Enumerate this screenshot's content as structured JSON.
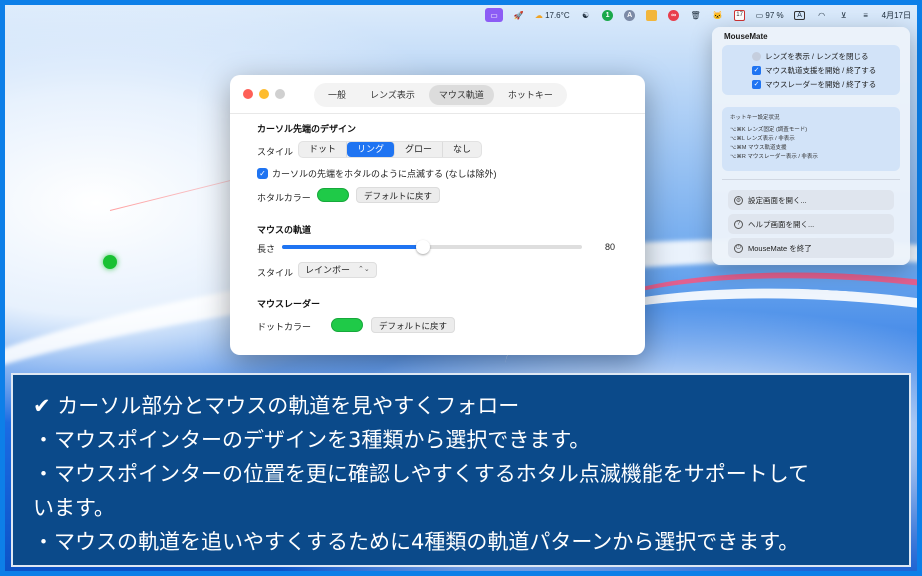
{
  "menubar": {
    "temperature": "17.6°C",
    "badge_green": "1",
    "calendar_day": "17",
    "battery": "97 %",
    "input_source": "A",
    "date": "4月17日"
  },
  "window": {
    "tabs": [
      "一般",
      "レンズ表示",
      "マウス軌道",
      "ホットキー"
    ],
    "active_tab": "マウス軌道",
    "cursor_section": {
      "title": "カーソル先端のデザイン",
      "style_label": "スタイル",
      "style_options": [
        "ドット",
        "リング",
        "グロー",
        "なし"
      ],
      "style_selected": "リング",
      "blink_checkbox_label": "カーソルの先端をホタルのように点滅する (なしは除外)",
      "firefly_color_label": "ホタルカラー",
      "firefly_color": "#1fca48",
      "reset_label": "デフォルトに戻す"
    },
    "trail_section": {
      "title": "マウスの軌道",
      "length_label": "長さ",
      "length_value": "80",
      "length_fraction": 0.47,
      "style_label": "スタイル",
      "style_value": "レインボー"
    },
    "radar_section": {
      "title": "マウスレーダー",
      "dot_color_label": "ドットカラー",
      "dot_color": "#1fca48",
      "reset_label": "デフォルトに戻す"
    }
  },
  "panel": {
    "title": "MouseMate",
    "items": [
      "レンズを表示 / レンズを閉じる",
      "マウス軌道支援を開始 / 終了する",
      "マウスレーダーを開始 / 終了する"
    ],
    "hotkey_title": "ホットキー設定状況",
    "hotkeys": [
      "⌥⌘K レンズ固定 (調査モード)",
      "⌥⌘L レンズ表示 / 非表示",
      "⌥⌘M マウス軌道支援",
      "⌥⌘R マウスレーダー表示 / 非表示"
    ],
    "buttons": [
      "設定画面を開く...",
      "ヘルプ画面を開く...",
      "MouseMate を終了"
    ]
  },
  "caption": {
    "lines": [
      "✔ カーソル部分とマウスの軌道を見やすくフォロー",
      "・マウスポインターのデザインを3種類から選択できます。",
      "・マウスポインターの位置を更に確認しやすくするホタル点滅機能をサポートして",
      "います。",
      "・マウスの軌道を追いやすくするために4種類の軌道パターンから選択できます。"
    ]
  }
}
